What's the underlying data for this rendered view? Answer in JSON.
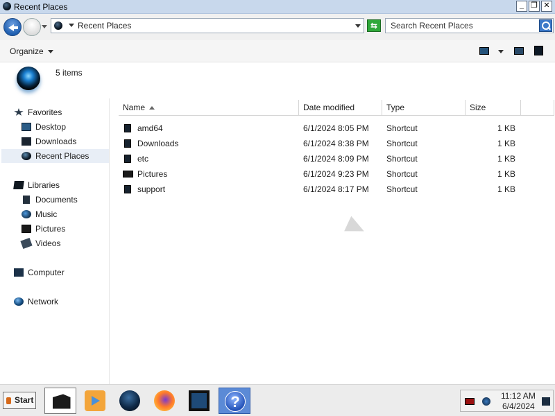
{
  "window": {
    "title": "Recent Places",
    "minimize_label": "_",
    "maximize_label": "❐",
    "close_label": "✕"
  },
  "address": {
    "path": "Recent Places",
    "refresh_label": "⇆"
  },
  "search": {
    "placeholder": "Search Recent Places"
  },
  "toolbar": {
    "organize_label": "Organize"
  },
  "details": {
    "item_count": "5 items"
  },
  "nav": {
    "favorites": "Favorites",
    "desktop": "Desktop",
    "downloads": "Downloads",
    "recent_places": "Recent Places",
    "libraries": "Libraries",
    "documents": "Documents",
    "music": "Music",
    "pictures": "Pictures",
    "videos": "Videos",
    "computer": "Computer",
    "network": "Network"
  },
  "columns": {
    "name": "Name",
    "date": "Date modified",
    "type": "Type",
    "size": "Size"
  },
  "files": [
    {
      "name": "amd64",
      "date": "6/1/2024 8:05 PM",
      "type": "Shortcut",
      "size": "1 KB"
    },
    {
      "name": "Downloads",
      "date": "6/1/2024 8:38 PM",
      "type": "Shortcut",
      "size": "1 KB"
    },
    {
      "name": "etc",
      "date": "6/1/2024 8:09 PM",
      "type": "Shortcut",
      "size": "1 KB"
    },
    {
      "name": "Pictures",
      "date": "6/1/2024 9:23 PM",
      "type": "Shortcut",
      "size": "1 KB"
    },
    {
      "name": "support",
      "date": "6/1/2024 8:17 PM",
      "type": "Shortcut",
      "size": "1 KB"
    }
  ],
  "taskbar": {
    "start_label": "Start",
    "help_label": "?",
    "time": "11:12 AM",
    "date": "6/4/2024"
  }
}
